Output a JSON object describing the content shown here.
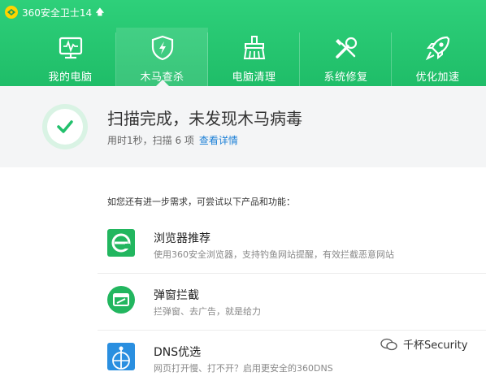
{
  "app": {
    "title": "360安全卫士14",
    "upgrade_icon": "up-arrow-icon"
  },
  "tabs": [
    {
      "label": "我的电脑",
      "icon": "monitor-icon",
      "active": false
    },
    {
      "label": "木马查杀",
      "icon": "shield-bolt-icon",
      "active": true
    },
    {
      "label": "电脑清理",
      "icon": "broom-icon",
      "active": false
    },
    {
      "label": "系统修复",
      "icon": "tools-icon",
      "active": false
    },
    {
      "label": "优化加速",
      "icon": "rocket-icon",
      "active": false
    }
  ],
  "result": {
    "title": "扫描完成，未发现木马病毒",
    "summary": "用时1秒，扫描 6 项",
    "details_link": "查看详情"
  },
  "suggestions": {
    "intro": "如您还有进一步需求，可尝试以下产品和功能：",
    "items": [
      {
        "name": "浏览器推荐",
        "desc": "使用360安全浏览器，支持钓鱼网站提醒，有效拦截恶意网站",
        "icon": "browser-icon"
      },
      {
        "name": "弹窗拦截",
        "desc": "拦弹窗、去广告，就是给力",
        "icon": "popup-block-icon"
      },
      {
        "name": "DNS优选",
        "desc": "网页打开慢、打不开？启用更安全的360DNS",
        "icon": "dns-icon"
      }
    ]
  },
  "watermark": {
    "text": "千杯Security"
  },
  "colors": {
    "brand_green": "#22c06c",
    "link_blue": "#1a7fd6"
  }
}
